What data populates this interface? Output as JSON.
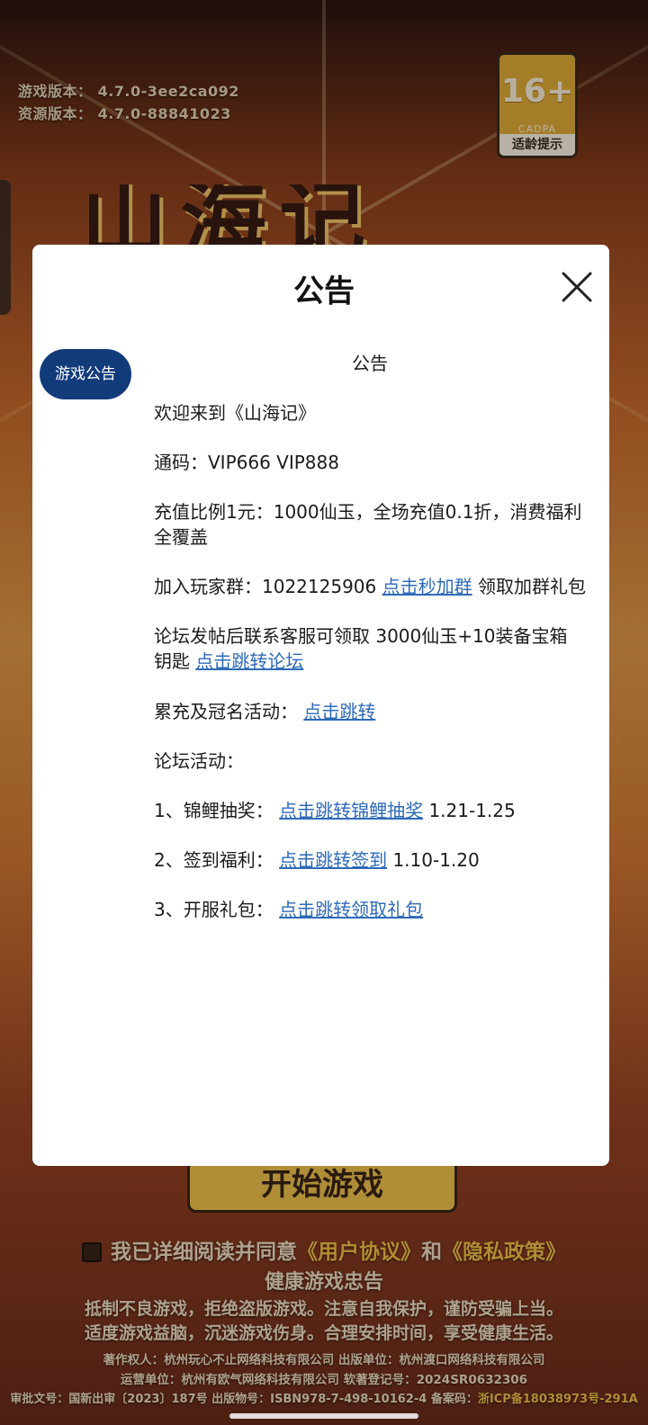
{
  "background": {
    "version_game": "游戏版本：  4.7.0-3ee2ca092",
    "version_resource": "资源版本：  4.7.0-88841023",
    "age_badge": {
      "rating": "16+",
      "org": "CADPA",
      "tip": "适龄提示"
    },
    "title_art": "山海记",
    "start_button": "开始游戏",
    "agreement": {
      "prefix": "我已详细阅读并同意",
      "user_agreement": "《用户协议》",
      "and": "和",
      "privacy_policy": "《隐私政策》"
    },
    "health": {
      "title": "健康游戏忠告",
      "line1": "抵制不良游戏，拒绝盗版游戏。注意自我保护，谨防受骗上当。",
      "line2": "适度游戏益脑，沉迷游戏伤身。合理安排时间，享受健康生活。"
    },
    "credits": {
      "line1": "著作权人：杭州玩心不止网络科技有限公司  出版单位：杭州渡口网络科技有限公司",
      "line2": "运营单位：杭州有欧气网络科技有限公司  软著登记号：2024SR0632306",
      "line3_prefix": "审批文号：国新出审〔2023〕187号  出版物号：ISBN978-7-498-10162-4  备案码：",
      "line3_link": "浙ICP备18038973号-291A"
    }
  },
  "modal": {
    "title": "公告",
    "close_icon": "close-icon",
    "tabs": [
      {
        "label": "游戏公告",
        "active": true
      }
    ],
    "content": {
      "heading": "公告",
      "welcome": "欢迎来到《山海记》",
      "codes": "通码：VIP666 VIP888",
      "recharge_line1": "充值比例1元：1000仙玉，全场充值0.1折，消费福利",
      "recharge_line2": "全覆盖",
      "group_prefix": "加入玩家群：1022125906 ",
      "group_link": "点击秒加群",
      "group_suffix": " 领取加群礼包",
      "forum_line1": "论坛发帖后联系客服可领取 3000仙玉+10装备宝箱",
      "forum_line2_prefix": "钥匙 ",
      "forum_link": "点击跳转论坛",
      "event_prefix": "累充及冠名活动：  ",
      "event_link": "点击跳转",
      "forum_activities": "论坛活动：",
      "item1_prefix": "1、锦鲤抽奖：  ",
      "item1_link": "点击跳转锦鲤抽奖",
      "item1_suffix": " 1.21-1.25",
      "item2_prefix": "2、签到福利：  ",
      "item2_link": "点击跳转签到",
      "item2_suffix": " 1.10-1.20",
      "item3_prefix": "3、开服礼包：  ",
      "item3_link": "点击跳转领取礼包"
    }
  },
  "colors": {
    "tab_active": "#123b7a",
    "link": "#2e6ab8",
    "modal_bg": "#ffffff"
  }
}
